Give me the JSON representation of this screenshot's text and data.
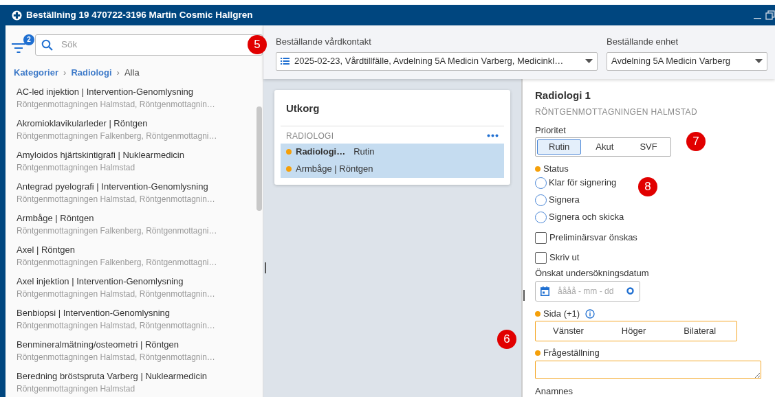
{
  "window": {
    "title": "Beställning 19 470722-3196 Martin Cosmic Hallgren"
  },
  "sidebar": {
    "filter_badge": "2",
    "search": {
      "placeholder": "Sök",
      "callout": "5"
    },
    "breadcrumb": [
      {
        "label": "Kategorier",
        "kind": "link",
        "separator": "›"
      },
      {
        "label": "Radiologi",
        "kind": "link",
        "separator": "›"
      },
      {
        "label": "Alla",
        "kind": "current"
      }
    ],
    "items": [
      {
        "title": "AC-led injektion | Intervention-Genomlysning",
        "subtitle": "Röntgenmottagningen Halmstad, Röntgenmottagnin…"
      },
      {
        "title": "Akromioklavikularleder | Röntgen",
        "subtitle": "Röntgenmottagningen Falkenberg, Röntgenmottagni…"
      },
      {
        "title": "Amyloidos hjärtskintigrafi | Nuklearmedicin",
        "subtitle": "Röntgenmottagningen Halmstad"
      },
      {
        "title": "Antegrad pyelografi | Intervention-Genomlysning",
        "subtitle": "Röntgenmottagningen Halmstad, Röntgenmottagnin…"
      },
      {
        "title": "Armbåge | Röntgen",
        "subtitle": "Röntgenmottagningen Falkenberg, Röntgenmottagni…"
      },
      {
        "title": "Axel | Röntgen",
        "subtitle": "Röntgenmottagningen Falkenberg, Röntgenmottagni…"
      },
      {
        "title": "Axel injektion | Intervention-Genomlysning",
        "subtitle": "Röntgenmottagningen Halmstad, Röntgenmottagnin…"
      },
      {
        "title": "Benbiopsi | Intervention-Genomlysning",
        "subtitle": "Röntgenmottagningen Halmstad, Röntgenmottagnin…"
      },
      {
        "title": "Benmineralmätning/osteometri | Röntgen",
        "subtitle": "Röntgenmottagningen Halmstad, Röntgenmottagnin…"
      },
      {
        "title": "Beredning bröstspruta Varberg | Nuklearmedicin",
        "subtitle": "Röntgenmottagningen Halmstad"
      }
    ]
  },
  "header": {
    "fields": [
      {
        "label": "Beställande vårdkontakt",
        "value": "2025-02-23, Vårdtillfälle, Avdelning 5A Medicin Varberg, Medicinkl…",
        "kind": "list"
      },
      {
        "label": "Beställande enhet",
        "value": "Avdelning 5A Medicin Varberg",
        "kind": "plain"
      }
    ]
  },
  "outbox": {
    "title": "Utkorg",
    "section": "RADIOLOGI",
    "items": [
      {
        "name": "Radiologi…",
        "priority": "Rutin",
        "selected": true,
        "current": true
      },
      {
        "name": "Armbåge | Röntgen",
        "selected": true,
        "current": false
      }
    ]
  },
  "form": {
    "title": "Radiologi 1",
    "subtitle": "RÖNTGENMOTTAGNINGEN HALMSTAD",
    "priority": {
      "label": "Prioritet",
      "callout": "7",
      "options": [
        {
          "label": "Rutin",
          "selected": true
        },
        {
          "label": "Akut",
          "selected": false
        },
        {
          "label": "SVF",
          "selected": false
        }
      ]
    },
    "status": {
      "label": "Status",
      "required": true,
      "callout": "8",
      "options": [
        {
          "label": "Klar för signering",
          "checked": false
        },
        {
          "label": "Signera",
          "checked": false
        },
        {
          "label": "Signera och skicka",
          "checked": false
        }
      ]
    },
    "checkboxes": [
      {
        "label": "Preliminärsvar önskas",
        "checked": false
      },
      {
        "label": "Skriv ut",
        "checked": false
      }
    ],
    "date": {
      "label": "Önskat undersökningsdatum",
      "placeholder": "åååå - mm - dd"
    },
    "side": {
      "label": "Sida (+1)",
      "required": true,
      "callout": "6",
      "options": [
        {
          "label": "Vänster",
          "selected": false
        },
        {
          "label": "Höger",
          "selected": false
        },
        {
          "label": "Bilateral",
          "selected": false
        }
      ]
    },
    "question": {
      "label": "Frågeställning",
      "required": true
    },
    "anamnes": {
      "label": "Anamnes"
    }
  }
}
